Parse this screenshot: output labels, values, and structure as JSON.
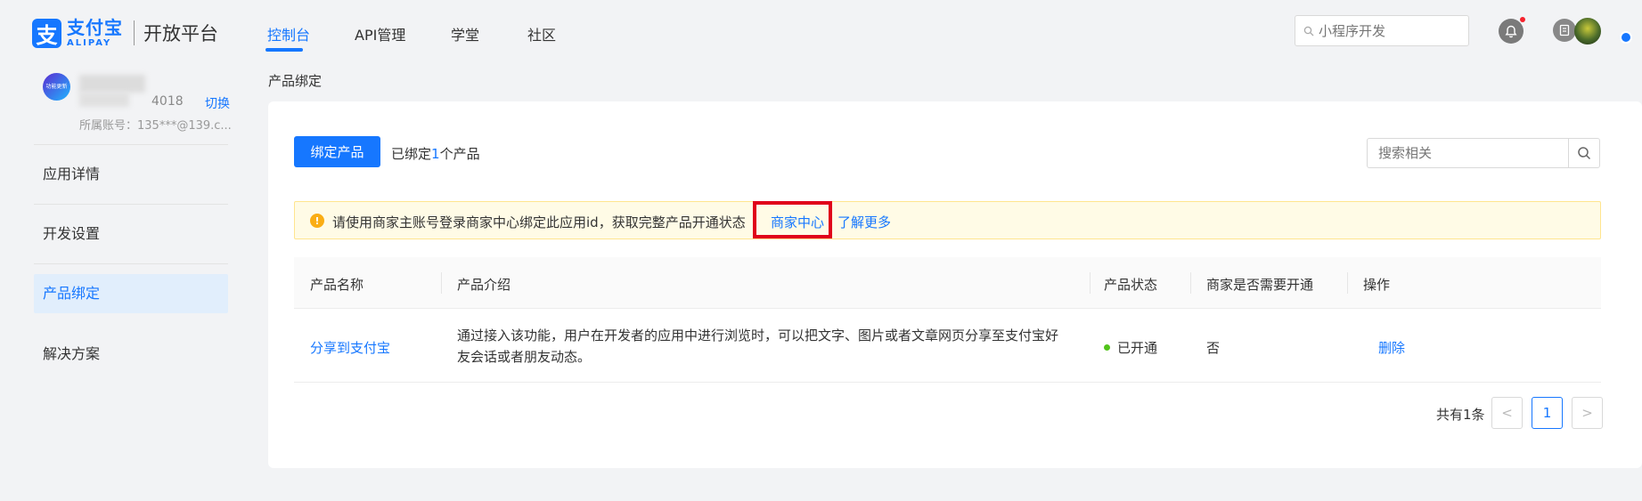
{
  "header": {
    "logo_cn": "支付宝",
    "logo_en": "ALIPAY",
    "platform": "开放平台",
    "nav": [
      "控制台",
      "API管理",
      "学堂",
      "社区"
    ],
    "active_nav": "控制台",
    "search_placeholder": "小程序开发"
  },
  "sidebar": {
    "account_avatar_text": "功能更新",
    "account_id_suffix": "4018",
    "switch_label": "切换",
    "account_sub": "所属账号：135***@139.c...",
    "items": [
      {
        "label": "应用详情",
        "active": false
      },
      {
        "label": "开发设置",
        "active": false
      },
      {
        "label": "产品绑定",
        "active": true
      },
      {
        "label": "解决方案",
        "active": false
      }
    ]
  },
  "main": {
    "breadcrumb": "产品绑定",
    "bind_button": "绑定产品",
    "bound_prefix": "已绑定",
    "bound_count": "1",
    "bound_suffix": "个产品",
    "search_placeholder": "搜索相关",
    "alert": {
      "text": "请使用商家主账号登录商家中心绑定此应用id，获取完整产品开通状态",
      "link1": "商家中心",
      "link2": "了解更多"
    },
    "table": {
      "headers": [
        "产品名称",
        "产品介绍",
        "产品状态",
        "商家是否需要开通",
        "操作"
      ],
      "rows": [
        {
          "name": "分享到支付宝",
          "desc": "通过接入该功能，用户在开发者的应用中进行浏览时，可以把文字、图片或者文章网页分享至支付宝好友会话或者朋友动态。",
          "status": "已开通",
          "need_open": "否",
          "op": "删除"
        }
      ]
    },
    "pagination": {
      "total": "共有1条",
      "prev": "<",
      "current": "1",
      "next": ">"
    }
  },
  "colors": {
    "accent": "#1677ff",
    "highlight": "#e0001a",
    "warning": "#faad14",
    "success": "#52c41a"
  }
}
